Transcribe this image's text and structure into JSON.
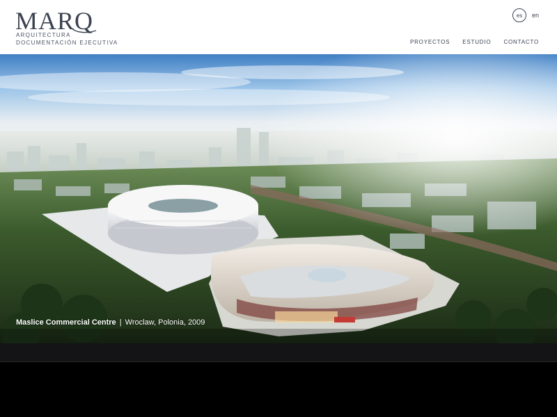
{
  "brand": {
    "name": "MARQ",
    "line1": "ARQUITECTURA",
    "line2": "DOCUMENTACIÓN EJECUTIVA"
  },
  "languages": {
    "active": "es",
    "other": "en"
  },
  "nav": {
    "items": [
      "PROYECTOS",
      "ESTUDIO",
      "CONTACTO"
    ]
  },
  "hero": {
    "project_title": "Maslice Commercial Centre",
    "separator": "|",
    "project_location": "Wroclaw, Polonia, 2009"
  },
  "colors": {
    "text": "#3b4250",
    "header_bg": "#ffffff",
    "page_bg": "#000000",
    "bar_bg": "#141416"
  }
}
